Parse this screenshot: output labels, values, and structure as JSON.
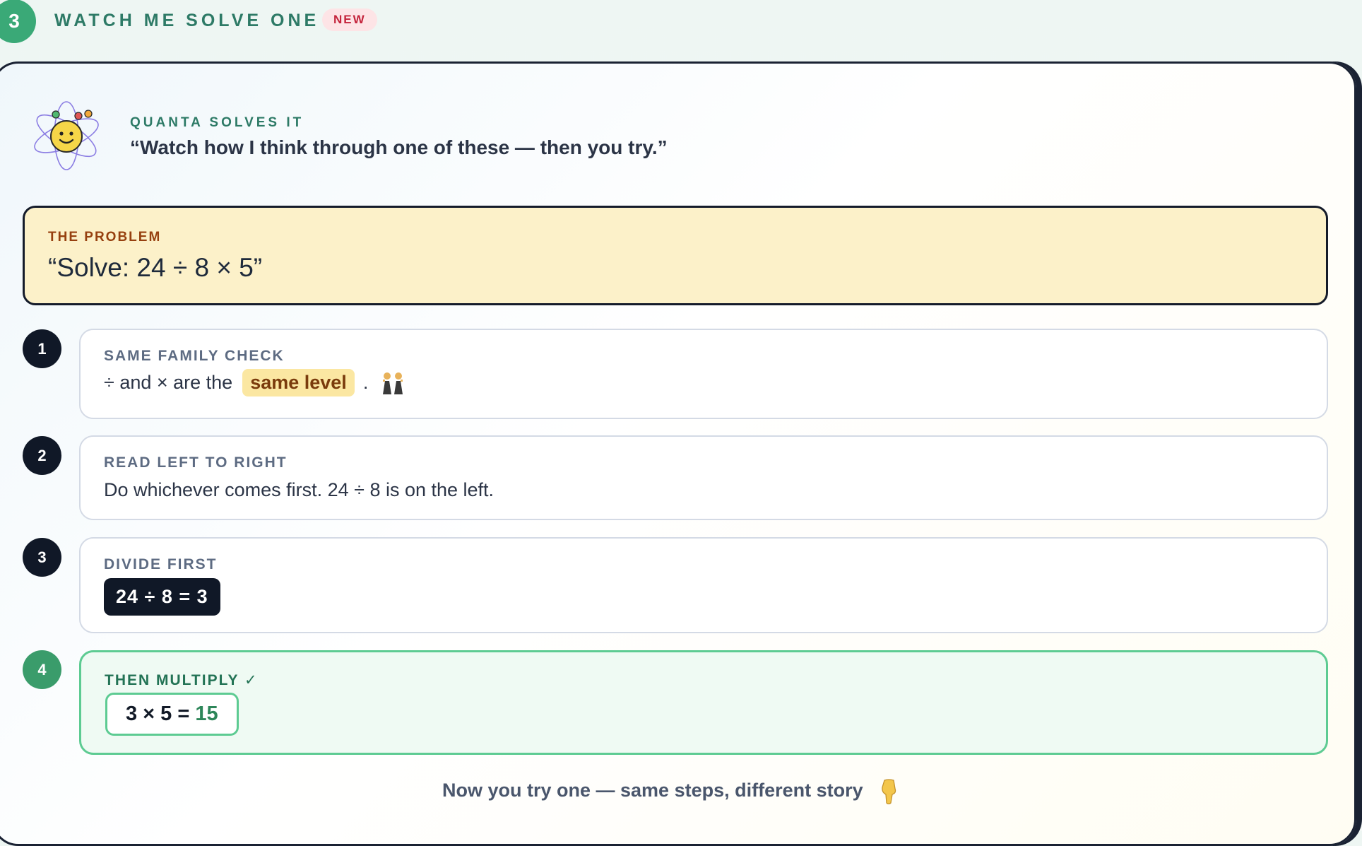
{
  "section": {
    "number": "3",
    "title": "WATCH ME SOLVE ONE",
    "badge": "NEW"
  },
  "intro": {
    "label": "QUANTA SOLVES IT",
    "quote": "“Watch how I think through one of these — then you try.”",
    "mascot_icon": "smiley-atom-icon"
  },
  "problem": {
    "label": "THE PROBLEM",
    "text": "“Solve: 24 ÷ 8 × 5”"
  },
  "steps": [
    {
      "number": "1",
      "title": "SAME FAMILY CHECK",
      "body_before": "÷ and × are the",
      "highlight": "same level",
      "body_after": ".",
      "icon": "two-people-icon"
    },
    {
      "number": "2",
      "title": "READ LEFT TO RIGHT",
      "body": "Do whichever comes first. 24 ÷ 8 is on the left."
    },
    {
      "number": "3",
      "title": "DIVIDE FIRST",
      "equation": "24 ÷ 8 = 3"
    },
    {
      "number": "4",
      "title": "THEN MULTIPLY ✓",
      "equation_left": "3 × 5 =",
      "equation_answer": "15"
    }
  ],
  "footer": {
    "text": "Now you try one — same steps, different story",
    "icon": "pointing-down-icon"
  },
  "colors": {
    "accent_green": "#3aa977",
    "problem_bg": "#fcf1c9",
    "highlight_bg": "#fbe7a2",
    "dark": "#101827",
    "new_badge": "#c4243c"
  }
}
